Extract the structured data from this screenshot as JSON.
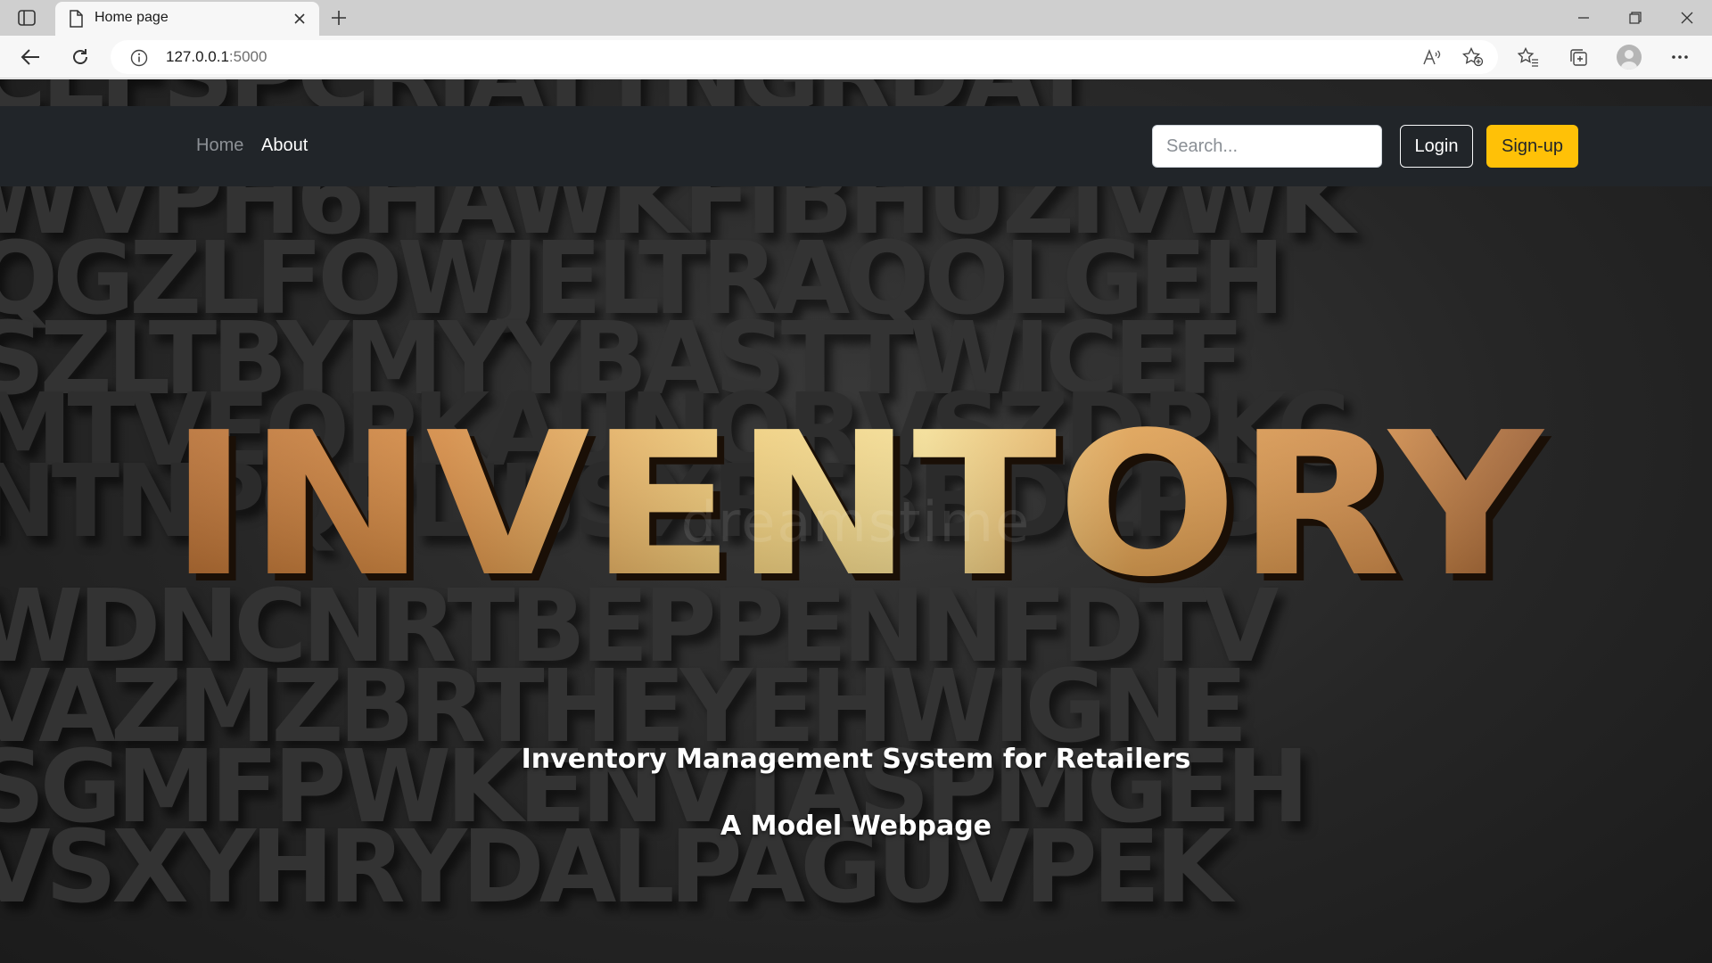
{
  "browser": {
    "tab_title": "Home page",
    "url_host": "127.0.0.1",
    "url_port": ":5000",
    "icons": [
      "tab-actions-icon",
      "document-icon",
      "close-icon",
      "plus-icon",
      "minimize-icon",
      "restore-icon",
      "window-close-icon",
      "back-icon",
      "refresh-icon",
      "info-icon",
      "read-aloud-icon",
      "add-favorite-icon",
      "favorites-icon",
      "collections-icon",
      "profile-icon",
      "more-icon"
    ]
  },
  "navbar": {
    "links": [
      {
        "label": "Home",
        "color": "#8c9095"
      },
      {
        "label": "About",
        "color": "#ffffff"
      }
    ],
    "search_placeholder": "Search...",
    "login_label": "Login",
    "signup_label": "Sign-up",
    "signup_color": "#ffc107",
    "background": "#212529"
  },
  "hero": {
    "image_word": "INVENTORY",
    "watermark": "dreamstime",
    "background_letters": [
      "CLFSPCRIATTNGRDAT",
      "WVPH6HAWKFIBHUZIVWK",
      "QGZLFOWJELTRAQOLGEH",
      "SZLTBYMYYBASTTWICEF",
      "MTVEOPKAUNQRVSZDPKC",
      "NTNPQPLIUSXRFBBDZPD",
      "WDNCNRTBEPPENNFDTV",
      "VAZMZBRTHEYEHWIGNE",
      "SGMFPWKENVTASPMGEH",
      "VSXYHRYDALPAGUVPEK"
    ],
    "tagline": "Inventory Management System for Retailers",
    "subtitle": "A Model Webpage"
  }
}
